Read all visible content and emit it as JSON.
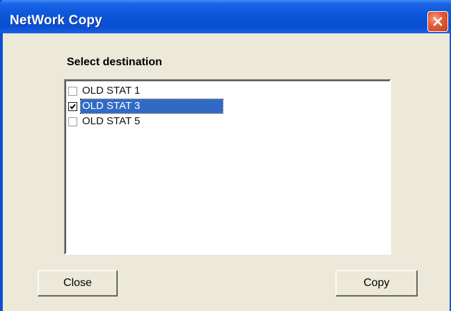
{
  "window": {
    "title": "NetWork Copy",
    "close_icon": "close-x-icon"
  },
  "destination": {
    "label": "Select destination",
    "items": [
      {
        "label": "OLD STAT 1",
        "checked": false,
        "selected": false
      },
      {
        "label": "OLD STAT 3",
        "checked": true,
        "selected": true
      },
      {
        "label": "OLD STAT 5",
        "checked": false,
        "selected": false
      }
    ]
  },
  "buttons": {
    "close_label": "Close",
    "copy_label": "Copy"
  },
  "colors": {
    "titlebar": "#0a4fd3",
    "selection": "#316ac5",
    "close_button": "#e05a33",
    "dialog_background": "#ece9d8"
  }
}
